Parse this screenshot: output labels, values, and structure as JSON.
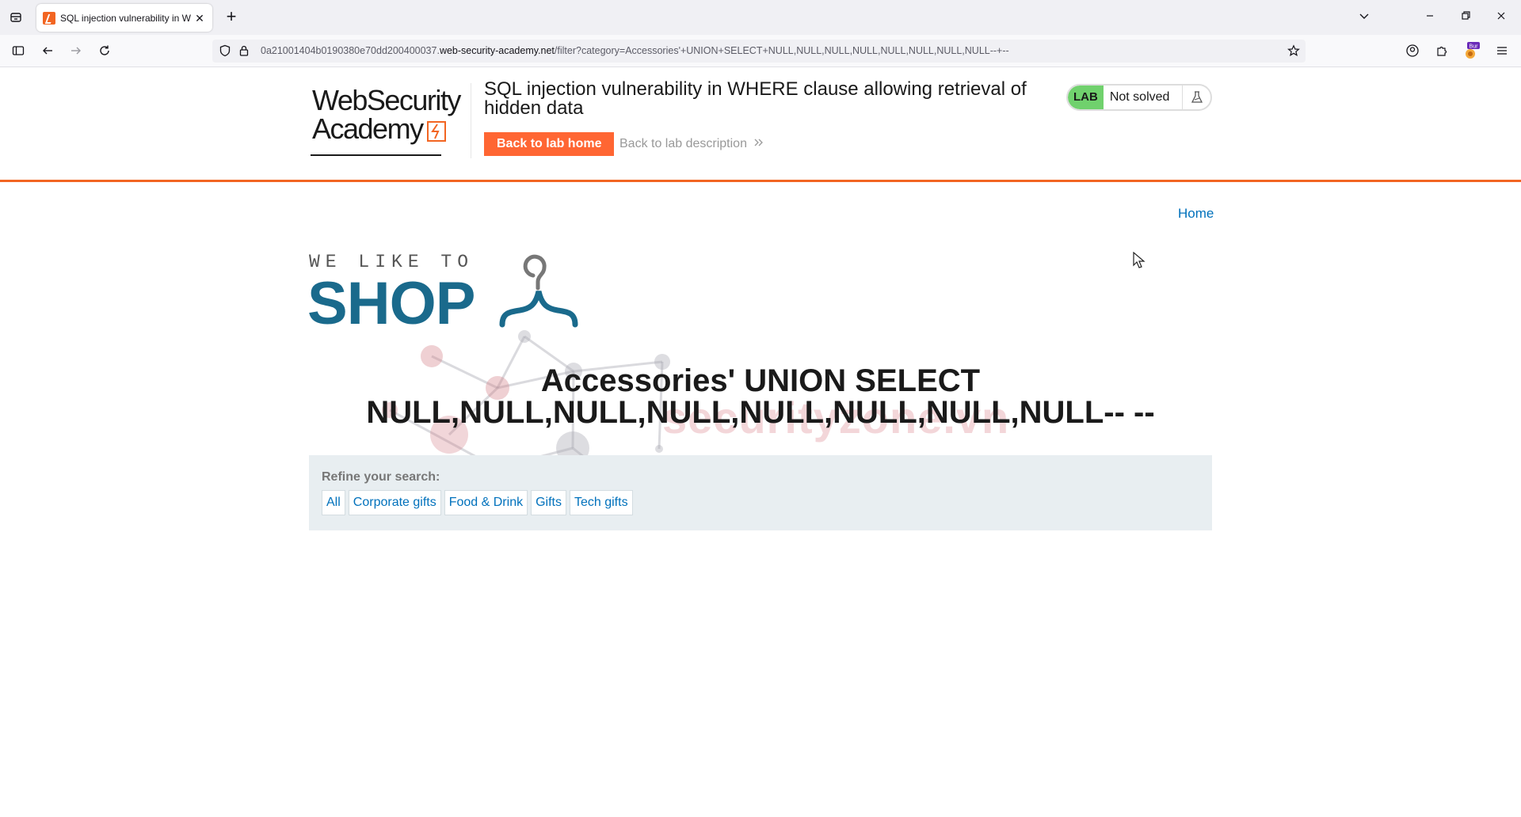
{
  "browser": {
    "tab_title": "SQL injection vulnerability in W",
    "tab_close": "✕",
    "new_tab": "+",
    "url_prefix": "0a21001404b0190380e70dd200400037.",
    "url_domain": "web-security-academy.net",
    "url_path": "/filter?category=Accessories'+UNION+SELECT+NULL,NULL,NULL,NULL,NULL,NULL,NULL,NULL--+--",
    "extension_badge": "Bur"
  },
  "lab": {
    "logo_line1": "WebSecurity",
    "logo_line2": "Academy",
    "title": "SQL injection vulnerability in WHERE clause allowing retrieval of hidden data",
    "back_home_label": "Back to lab home",
    "back_description_label": "Back to lab description",
    "badge": "LAB",
    "status": "Not solved",
    "accent_color": "#ff6633",
    "badge_color": "#70d16d"
  },
  "shop": {
    "home_link": "Home",
    "tagline": "WE LIKE TO",
    "shop_word": "SHOP",
    "brand_color": "#1a6a8c",
    "category_heading_line1": "Accessories' UNION SELECT",
    "category_heading_line2": "NULL,NULL,NULL,NULL,NULL,NULL,NULL,NULL-- --",
    "refine_label": "Refine your search:",
    "filters": [
      "All",
      "Corporate gifts",
      "Food & Drink",
      "Gifts",
      "Tech gifts"
    ],
    "watermark": "securityzone.vn"
  }
}
